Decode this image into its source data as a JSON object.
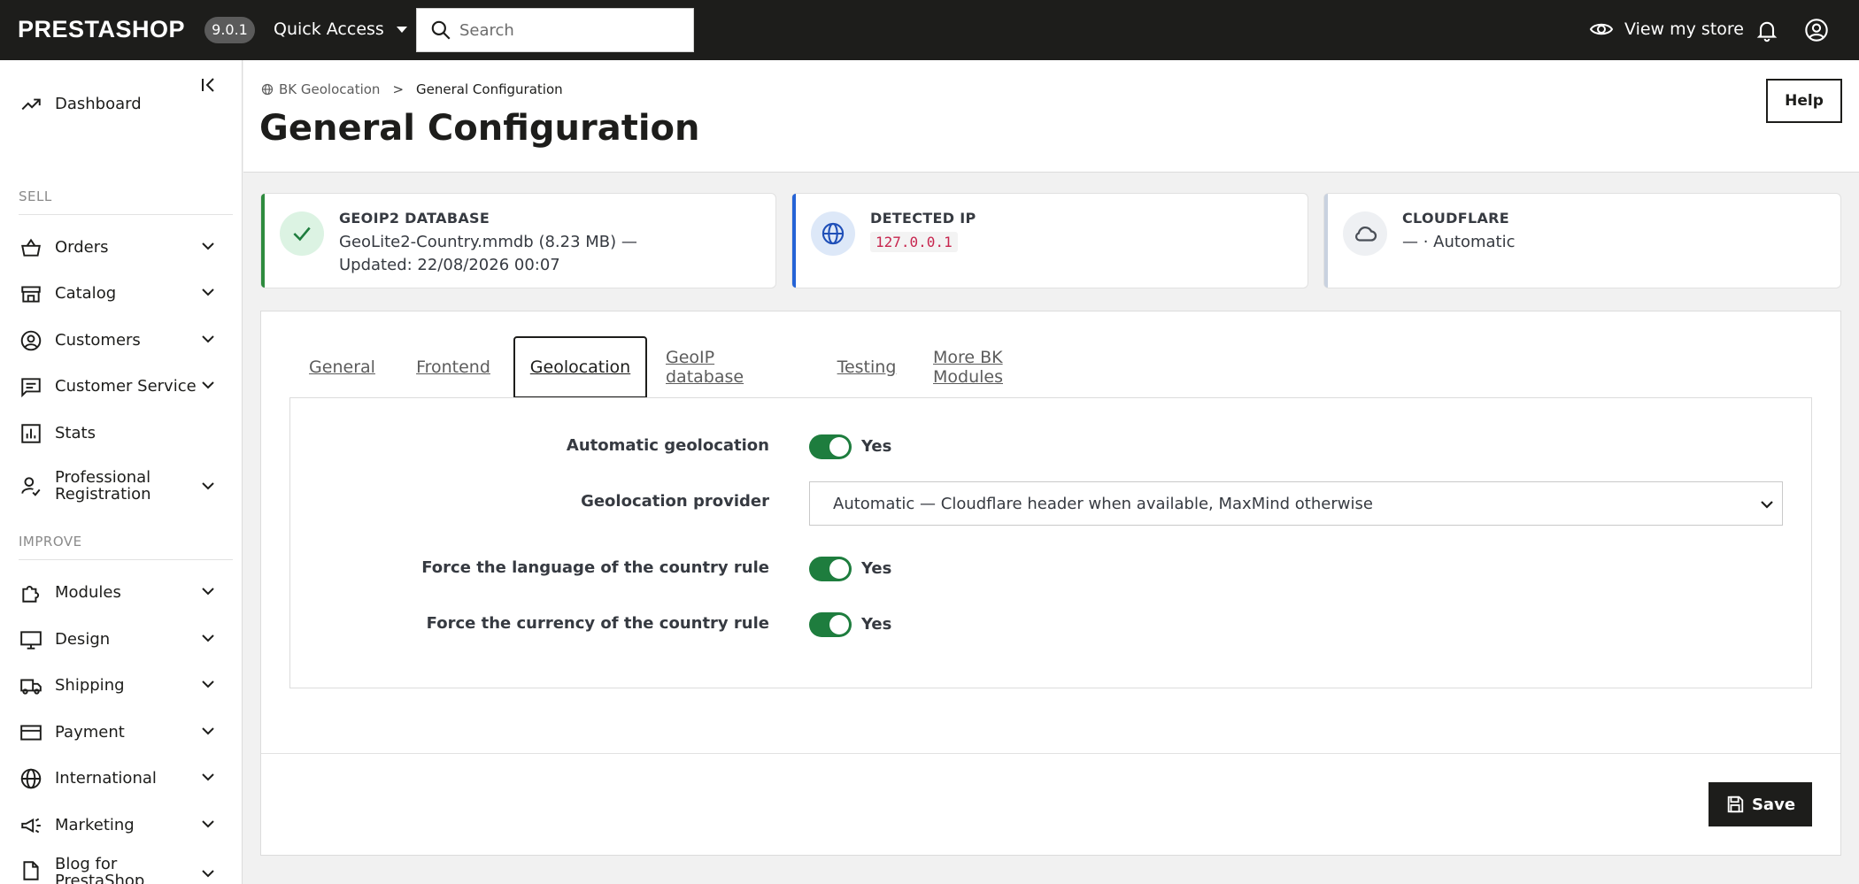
{
  "topbar": {
    "logo": "PRESTASHOP",
    "version": "9.0.1",
    "quick_access": "Quick Access",
    "search_placeholder": "Search",
    "view_store": "View my store"
  },
  "sidebar": {
    "items": [
      {
        "label": "Dashboard",
        "icon": "trending-up-icon"
      },
      {
        "label": "Orders",
        "icon": "shopping-basket-icon"
      },
      {
        "label": "Catalog",
        "icon": "store-icon"
      },
      {
        "label": "Customers",
        "icon": "account-circle-icon"
      },
      {
        "label": "Customer Service",
        "icon": "chat-icon"
      },
      {
        "label": "Stats",
        "icon": "bar-chart-icon"
      },
      {
        "label": "Professional Registration",
        "icon": "person-check-icon"
      },
      {
        "label": "Modules",
        "icon": "puzzle-icon"
      },
      {
        "label": "Design",
        "icon": "monitor-icon"
      },
      {
        "label": "Shipping",
        "icon": "truck-icon"
      },
      {
        "label": "Payment",
        "icon": "credit-card-icon"
      },
      {
        "label": "International",
        "icon": "globe-icon"
      },
      {
        "label": "Marketing",
        "icon": "megaphone-icon"
      },
      {
        "label": "Blog for PrestaShop",
        "icon": "document-icon"
      }
    ],
    "sections": {
      "sell": "SELL",
      "improve": "IMPROVE"
    }
  },
  "header": {
    "breadcrumb_parent": "BK Geolocation",
    "breadcrumb_sep": ">",
    "breadcrumb_current": "General Configuration",
    "title": "General Configuration",
    "help": "Help"
  },
  "cards": [
    {
      "title": "GEOIP2 DATABASE",
      "value": "GeoLite2-Country.mmdb (8.23 MB) — Updated: 22/08/2026 00:07",
      "color": "#2e8b3e"
    },
    {
      "title": "DETECTED IP",
      "value": "127.0.0.1",
      "color": "#2563d6"
    },
    {
      "title": "CLOUDFLARE",
      "value": "— · Automatic",
      "color": "#c9d2df"
    }
  ],
  "tabs": [
    "General",
    "Frontend",
    "Geolocation",
    "GeoIP database",
    "Testing",
    "More BK Modules"
  ],
  "form": {
    "auto_geo_label": "Automatic geolocation",
    "auto_geo_value": "Yes",
    "provider_label": "Geolocation provider",
    "provider_value": "Automatic — Cloudflare header when available, MaxMind otherwise",
    "force_lang_label": "Force the language of the country rule",
    "force_lang_value": "Yes",
    "force_currency_label": "Force the currency of the country rule",
    "force_currency_value": "Yes"
  },
  "save": "Save"
}
